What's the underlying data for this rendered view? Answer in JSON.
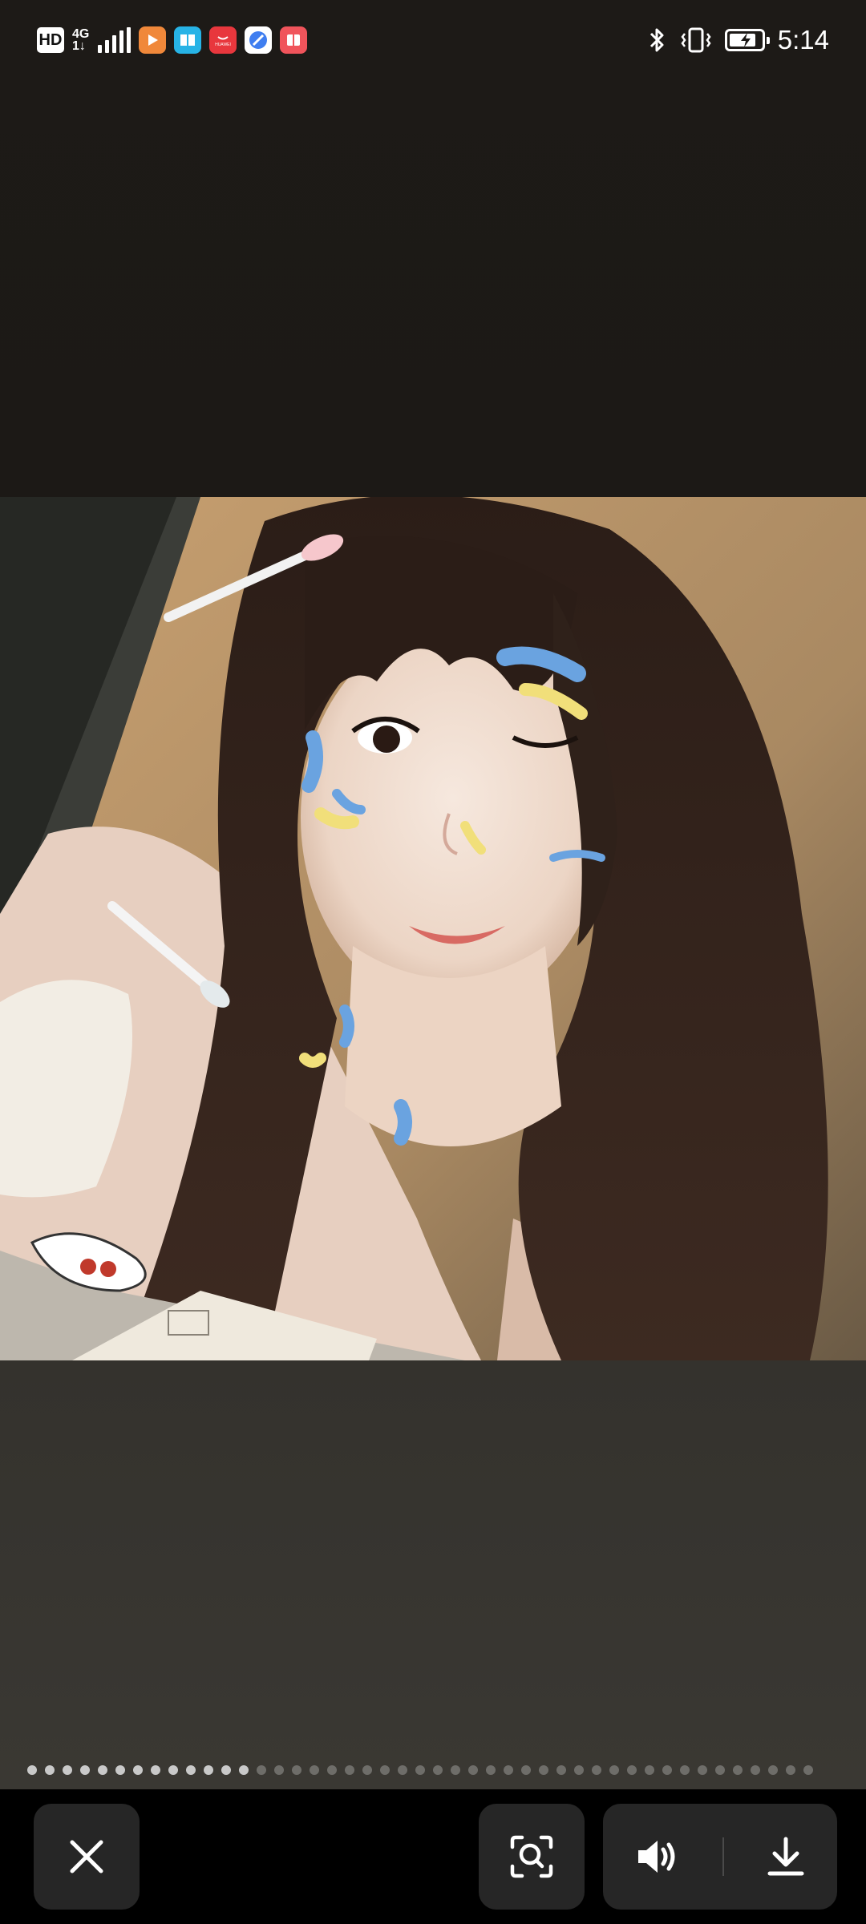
{
  "status_bar": {
    "hd_badge": "HD",
    "network_type": "4G",
    "network_sub": "1↓",
    "app_icons": [
      {
        "name": "video-app-icon",
        "color": "#f0883a"
      },
      {
        "name": "reader-app-icon",
        "color": "#27b3e6"
      },
      {
        "name": "huawei-store-icon",
        "color": "#e8373d",
        "label": "HUAWEI"
      },
      {
        "name": "browser-app-icon",
        "color": "#3f7ef0"
      },
      {
        "name": "books-app-icon",
        "color": "#f0545b"
      }
    ],
    "bluetooth_icon": "bluetooth-icon",
    "vibrate_icon": "vibrate-icon",
    "battery_level": 0.85,
    "charging": true,
    "time": "5:14"
  },
  "viewer": {
    "photo_subject": "selfie-photo",
    "page_indicator": {
      "total": 45,
      "viewed": 13
    }
  },
  "toolbar": {
    "buttons": [
      {
        "name": "close-button",
        "icon": "close-icon"
      },
      {
        "name": "lens-search-button",
        "icon": "image-search-icon"
      },
      {
        "name": "volume-button",
        "icon": "volume-icon"
      },
      {
        "name": "download-button",
        "icon": "download-icon"
      }
    ]
  },
  "colors": {
    "accent_dot_on": "#c9c9c9",
    "accent_dot_off": "#6e6d69",
    "toolbar_bg": "#000000",
    "button_bg": "#262626"
  }
}
